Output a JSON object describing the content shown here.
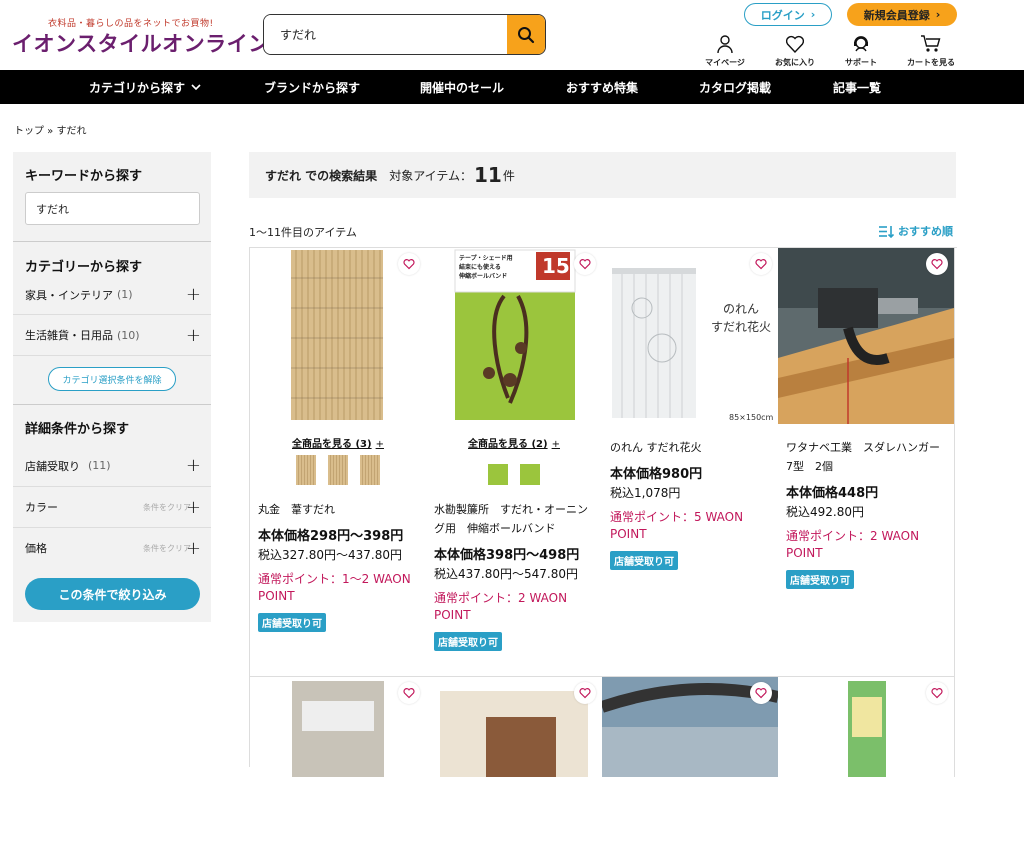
{
  "header": {
    "tagline": "衣料品・暮らしの品をネットでお買物!",
    "logo": "イオンスタイルオンライン",
    "search_value": "すだれ",
    "login_label": "ログイン",
    "signup_label": "新規会員登録",
    "icons": [
      {
        "name": "mypage-icon",
        "label": "マイページ"
      },
      {
        "name": "favorite-icon",
        "label": "お気に入り"
      },
      {
        "name": "support-icon",
        "label": "サポート"
      },
      {
        "name": "cart-icon",
        "label": "カートを見る"
      }
    ]
  },
  "nav": [
    "カテゴリから探す",
    "ブランドから探す",
    "開催中のセール",
    "おすすめ特集",
    "カタログ掲載",
    "記事一覧"
  ],
  "breadcrumb": "トップ » すだれ",
  "sidebar": {
    "keyword_heading": "キーワードから探す",
    "keyword_value": "すだれ",
    "category_heading": "カテゴリーから探す",
    "categories": [
      {
        "label": "家具・インテリア",
        "count": "(1)"
      },
      {
        "label": "生活雑貨・日用品",
        "count": "(10)"
      }
    ],
    "clear_category": "カテゴリ選択条件を解除",
    "detail_heading": "詳細条件から探す",
    "filters": [
      {
        "label": "店舗受取り",
        "count": "(11)",
        "clear": ""
      },
      {
        "label": "カラー",
        "count": "",
        "clear": "条件をクリア"
      },
      {
        "label": "価格",
        "count": "",
        "clear": "条件をクリア"
      }
    ],
    "apply_label": "この条件で絞り込み"
  },
  "results": {
    "query_label": "すだれ での検索結果",
    "target_label": "対象アイテム：",
    "count": "11",
    "unit": "件",
    "range_label": "1〜11件目のアイテム",
    "sort_label": "おすすめ順"
  },
  "products": [
    {
      "see_all": "全商品を見る (3)",
      "name": "丸金　葦すだれ",
      "price": "本体価格298円〜398円",
      "tax": "税込327.80円〜437.80円",
      "point": "通常ポイント：1〜2 WAON POINT",
      "pickup": "店舗受取り可"
    },
    {
      "see_all": "全商品を見る (2)",
      "name": "水勘製簾所　すだれ・オーニング用　伸縮ボールバンド",
      "price": "本体価格398円〜498円",
      "tax": "税込437.80円〜547.80円",
      "point": "通常ポイント：2 WAON POINT",
      "pickup": "店舗受取り可",
      "img_badge": "15",
      "img_text": "テープ・シェード用\n結束にも使える\n伸縮ボールバンド"
    },
    {
      "see_all": "",
      "name": "のれん すだれ花火",
      "price": "本体価格980円",
      "tax": "税込1,078円",
      "point": "通常ポイント：5 WAON POINT",
      "pickup": "店舗受取り可",
      "img_text": "のれん\nすだれ花火",
      "img_size": "85×150cm"
    },
    {
      "see_all": "",
      "name": "ワタナベ工業　スダレハンガー 7型　2個",
      "price": "本体価格448円",
      "tax": "税込492.80円",
      "point": "通常ポイント：2 WAON POINT",
      "pickup": "店舗受取り可"
    }
  ],
  "colors": {
    "accent": "#2a9fc6",
    "orange": "#f7a21b",
    "point": "#c2185b",
    "brand": "#6b1f6e"
  }
}
